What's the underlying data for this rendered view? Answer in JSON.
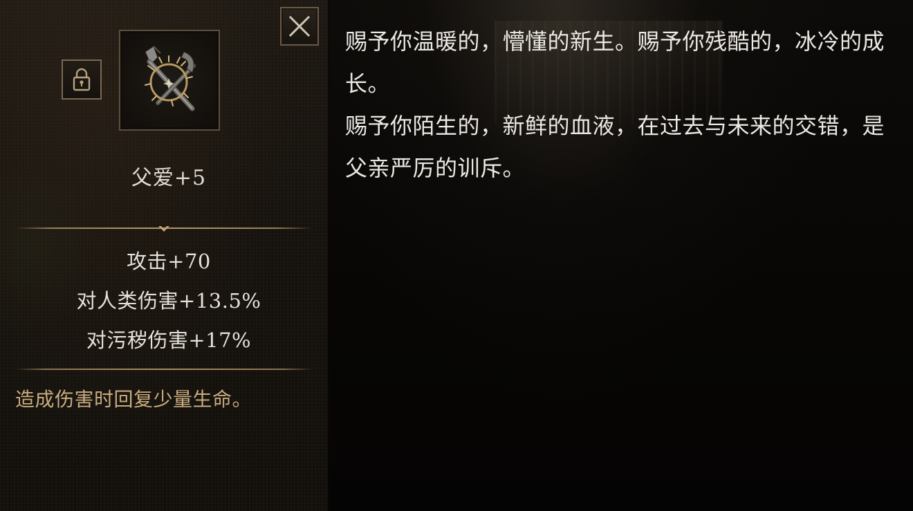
{
  "item": {
    "icon": "thorn-wreath-blades-icon",
    "name": "父爱+5",
    "stats": [
      "攻击+70",
      "对人类伤害+13.5%",
      "对污秽伤害+17%"
    ],
    "effect": "造成伤害时回复少量生命。"
  },
  "lore": {
    "lines": [
      "赐予你温暖的，懵懂的新生。赐予你残酷的，冰冷的成长。",
      "赐予你陌生的，新鲜的血液，在过去与未来的交错，是父亲严厉的训斥。"
    ]
  },
  "colors": {
    "accent_gold": "#c9ac7e",
    "divider_gold": "#b49a6c",
    "text_light": "#e6e1da"
  }
}
